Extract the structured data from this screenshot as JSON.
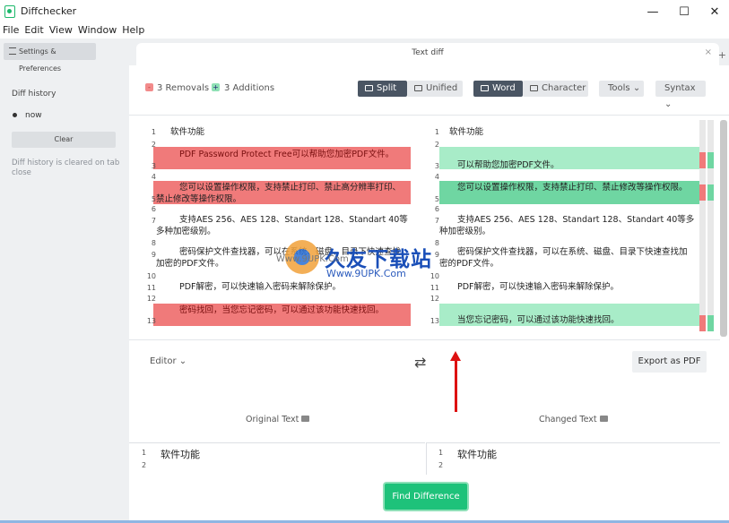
{
  "window": {
    "title": "Diffchecker",
    "minimize": "—",
    "maximize": "☐",
    "close": "✕"
  },
  "menu": [
    "File",
    "Edit",
    "View",
    "Window",
    "Help"
  ],
  "sidebar": {
    "tab_label": "Settings & Preferences",
    "history_heading": "Diff history",
    "history_item": "now",
    "clear_label": "Clear",
    "note": "Diff history is cleared on tab close"
  },
  "tab": {
    "title": "Text diff",
    "close": "×",
    "plus": "+"
  },
  "toolbar": {
    "removals": "3 Removals",
    "additions": "3 Additions",
    "split": "Split",
    "unified": "Unified",
    "word": "Word",
    "character": "Character",
    "tools": "Tools",
    "syntax": "Syntax"
  },
  "left_lines": [
    {
      "n": "1",
      "text": "软件功能"
    },
    {
      "n": "2",
      "text": ""
    },
    {
      "n": "3",
      "text": "PDF Password Protect Free可以帮助您加密PDF文件。"
    },
    {
      "n": "4",
      "text": ""
    },
    {
      "n": "5",
      "text": "您可以设置操作权限，支持禁止打印、禁止高分辨率打印、禁止修改等操作权限。"
    },
    {
      "n": "6",
      "text": ""
    },
    {
      "n": "7",
      "text": "支持AES 256、AES 128、Standart 128、Standart 40等多种加密级别。"
    },
    {
      "n": "8",
      "text": ""
    },
    {
      "n": "9",
      "text": "密码保护文件查找器，可以在系统、磁盘、目录下快速查找加密的PDF文件。"
    },
    {
      "n": "10",
      "text": ""
    },
    {
      "n": "11",
      "text": "PDF解密，可以快速输入密码来解除保护。"
    },
    {
      "n": "12",
      "text": ""
    },
    {
      "n": "13",
      "text": "密码找回，当您忘记密码，可以通过该功能快速找回。"
    }
  ],
  "right_lines": [
    {
      "n": "1",
      "text": "软件功能"
    },
    {
      "n": "2",
      "text": ""
    },
    {
      "n": "3",
      "text": "可以帮助您加密PDF文件。"
    },
    {
      "n": "4",
      "text": ""
    },
    {
      "n": "5",
      "text": "您可以设置操作权限，支持禁止打印、禁止修改等操作权限。"
    },
    {
      "n": "6",
      "text": ""
    },
    {
      "n": "7",
      "text": "支持AES 256、AES 128、Standart 128、Standart 40等多种加密级别。"
    },
    {
      "n": "8",
      "text": ""
    },
    {
      "n": "9",
      "text": "密码保护文件查找器，可以在系统、磁盘、目录下快速查找加密的PDF文件。"
    },
    {
      "n": "10",
      "text": ""
    },
    {
      "n": "11",
      "text": "PDF解密，可以快速输入密码来解除保护。"
    },
    {
      "n": "12",
      "text": ""
    },
    {
      "n": "13",
      "text": "当您忘记密码，可以通过该功能快速找回。"
    }
  ],
  "editor": {
    "label": "Editor",
    "swap": "⇄",
    "export": "Export as PDF",
    "original_label": "Original Text",
    "changed_label": "Changed Text",
    "left_line1": "软件功能",
    "right_line1": "软件功能",
    "find": "Find Difference"
  },
  "watermark": {
    "title": "久友下载站",
    "url": "Www.9UPK.Com",
    "url_small": "Www.9UPK.Com"
  },
  "colors": {
    "removal": "#f07a7a",
    "addition": "#a8ecc8",
    "accent": "#1ec27a",
    "arrow": "#dd1111"
  }
}
